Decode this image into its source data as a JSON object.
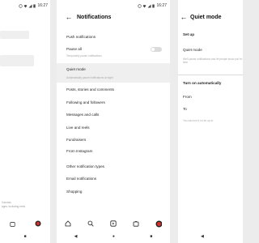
{
  "status_bar": {
    "time": "16:27"
  },
  "notifications": {
    "title": "Notifications",
    "push_notifications": "Push notifications",
    "pause_all": "Pause all",
    "pause_all_sub": "Temporarily pause notifications",
    "quiet_mode": "Quiet mode",
    "quiet_mode_sub": "Automatically pause notifications at night",
    "items": [
      "Posts, stories and comments",
      "Following and followers",
      "Messages and calls",
      "Live and reels",
      "Fundraisers",
      "From Instagram"
    ],
    "other_types": "Other notification types",
    "email_notifications": "Email notifications",
    "shopping": "Shopping"
  },
  "quiet": {
    "title": "Quiet mode",
    "set_up": "Set up",
    "quiet_mode": "Quiet mode",
    "desc": "We'll pause notifications and let people know you're in quiet mode during the time",
    "turn_on": "Turn on automatically",
    "from": "From",
    "to": "To",
    "footer": "You can turn it on for up to"
  },
  "left": {
    "footer_line1": "ll across",
    "footer_line2": "ages, including reels"
  },
  "icons": [
    "home-icon",
    "search-icon",
    "reels-icon",
    "shop-icon",
    "profile-icon",
    "back-icon",
    "home-button",
    "recents-icon"
  ]
}
